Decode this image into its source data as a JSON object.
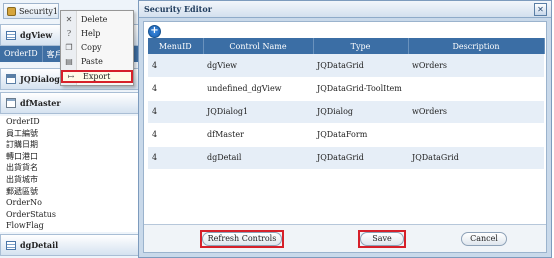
{
  "designer": {
    "security_tab": "Security1",
    "dgview": {
      "title": "dgView",
      "columns": [
        "OrderID",
        "客戶"
      ]
    },
    "jqdialog": {
      "title": "JQDialog1"
    },
    "dfmaster": {
      "title": "dfMaster",
      "fields": [
        "OrderID",
        "員工編號",
        "訂購日期",
        "轉口港口",
        "出貨貨名",
        "出貨城市",
        "郵遞區號",
        "OrderNo",
        "OrderStatus",
        "FlowFlag"
      ]
    },
    "dgdetail": {
      "title": "dgDetail"
    }
  },
  "context_menu": {
    "items": [
      {
        "label": "Delete",
        "icon": "close-icon"
      },
      {
        "label": "Help",
        "icon": "help-icon"
      },
      {
        "label": "Copy",
        "icon": "copy-icon"
      },
      {
        "label": "Paste",
        "icon": "paste-icon"
      },
      {
        "label": "Export",
        "icon": "export-icon"
      }
    ]
  },
  "dialog": {
    "title": "Security Editor",
    "columns": [
      "MenuID",
      "Control Name",
      "Type",
      "Description"
    ],
    "rows": [
      [
        "4",
        "dgView",
        "JQDataGrid",
        "wOrders"
      ],
      [
        "4",
        "undefined_dgView",
        "JQDataGrid-ToolItem",
        ""
      ],
      [
        "4",
        "JQDialog1",
        "JQDialog",
        "wOrders"
      ],
      [
        "4",
        "dfMaster",
        "JQDataForm",
        ""
      ],
      [
        "4",
        "dgDetail",
        "JQDataGrid",
        "JQDataGrid"
      ]
    ],
    "refresh_label": "Refresh Controls",
    "save_label": "Save",
    "cancel_label": "Cancel"
  },
  "colors": {
    "header_blue": "#3b6ea5",
    "highlight_red": "#d6202a",
    "row_alt": "#e6eef7"
  }
}
